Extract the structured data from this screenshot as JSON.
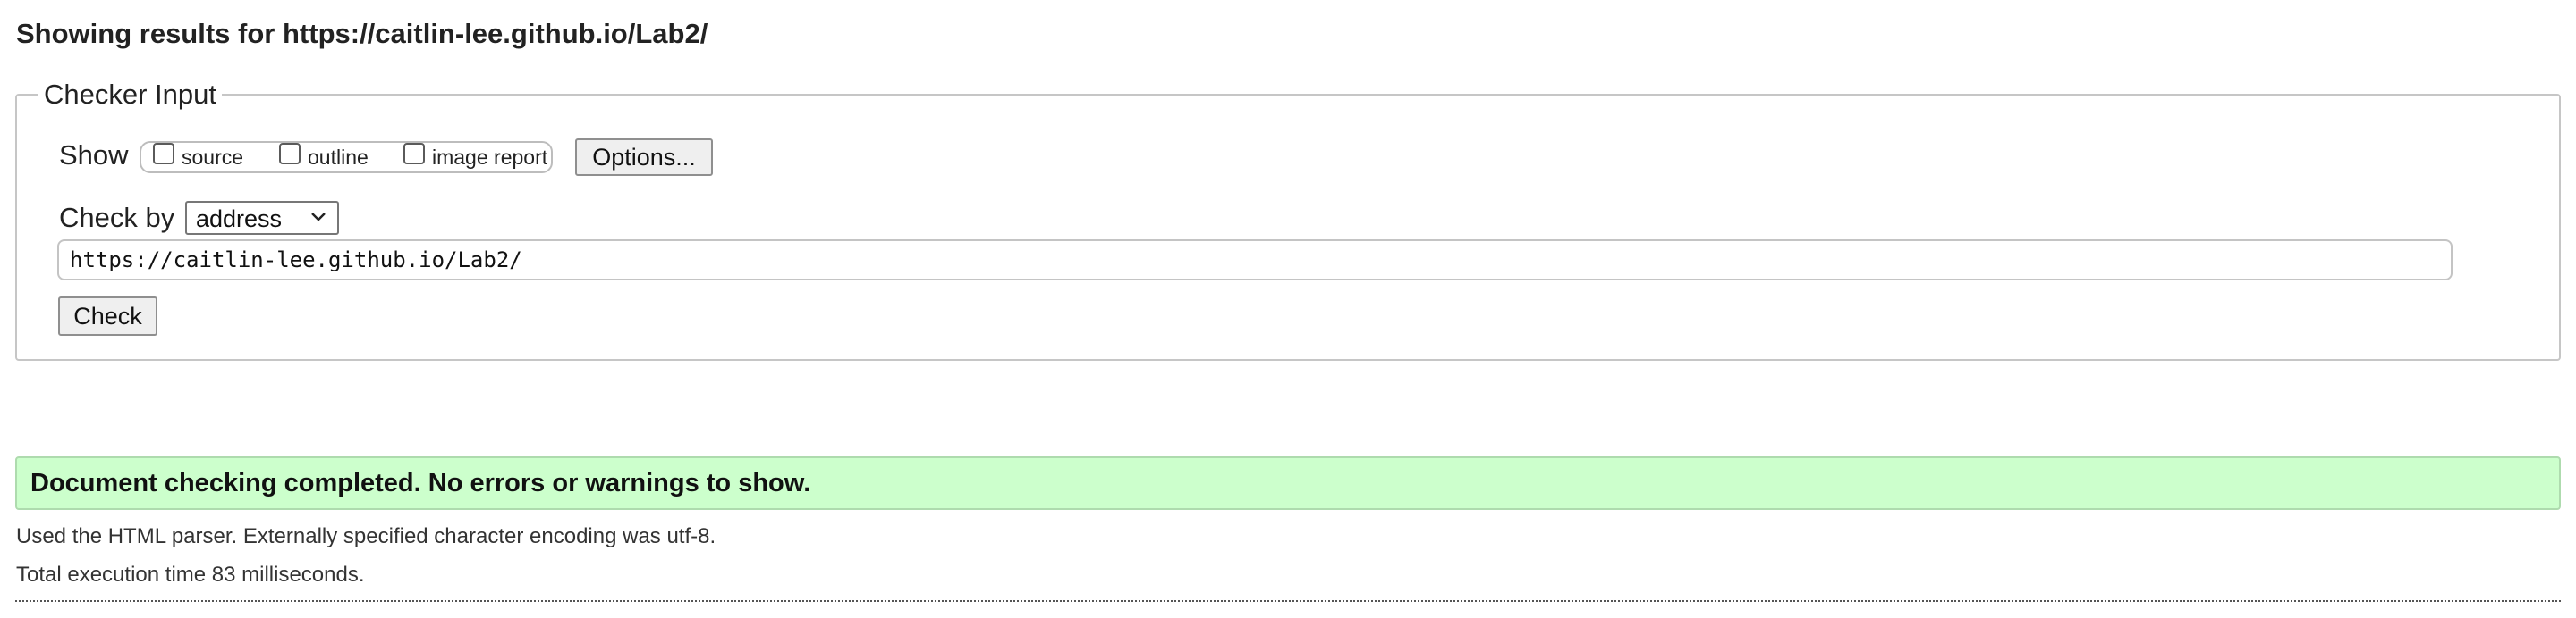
{
  "header": {
    "prefix": "Showing results for",
    "url": "https://caitlin-lee.github.io/Lab2/"
  },
  "checker": {
    "legend": "Checker Input",
    "show_label": "Show",
    "options": [
      {
        "label": "source",
        "checked": false
      },
      {
        "label": "outline",
        "checked": false
      },
      {
        "label": "image report",
        "checked": false
      }
    ],
    "options_button": "Options...",
    "check_by_label": "Check by",
    "check_by_value": "address",
    "url_value": "https://caitlin-lee.github.io/Lab2/",
    "check_button": "Check"
  },
  "results": {
    "success_message": "Document checking completed. No errors or warnings to show.",
    "parser_info": "Used the HTML parser. Externally specified character encoding was utf-8.",
    "execution_time": "Total execution time 83 milliseconds."
  },
  "colors": {
    "success_bg": "#ccffcc",
    "success_border": "#aedbae"
  },
  "icons": {
    "select_arrow": "chevron-down-icon"
  }
}
